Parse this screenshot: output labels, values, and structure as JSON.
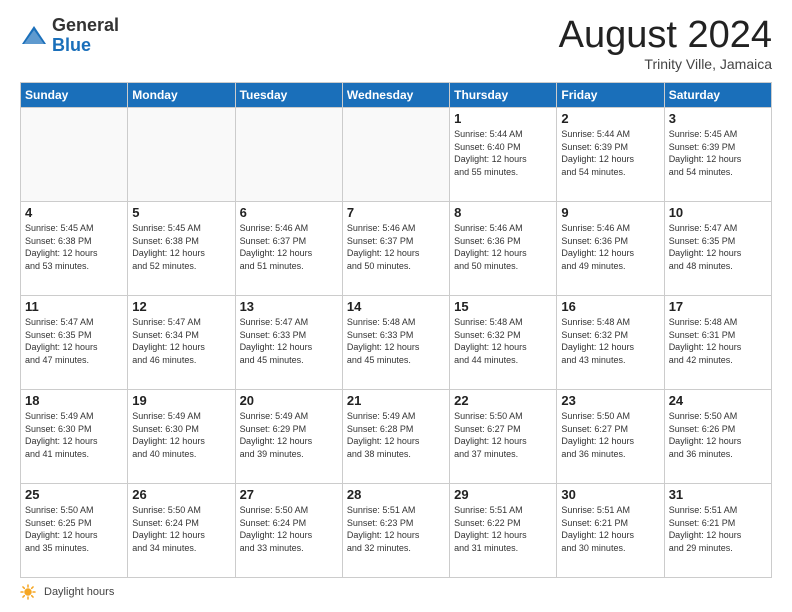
{
  "logo": {
    "general": "General",
    "blue": "Blue"
  },
  "title": "August 2024",
  "location": "Trinity Ville, Jamaica",
  "days_header": [
    "Sunday",
    "Monday",
    "Tuesday",
    "Wednesday",
    "Thursday",
    "Friday",
    "Saturday"
  ],
  "footer_label": "Daylight hours",
  "weeks": [
    [
      {
        "day": "",
        "info": ""
      },
      {
        "day": "",
        "info": ""
      },
      {
        "day": "",
        "info": ""
      },
      {
        "day": "",
        "info": ""
      },
      {
        "day": "1",
        "info": "Sunrise: 5:44 AM\nSunset: 6:40 PM\nDaylight: 12 hours\nand 55 minutes."
      },
      {
        "day": "2",
        "info": "Sunrise: 5:44 AM\nSunset: 6:39 PM\nDaylight: 12 hours\nand 54 minutes."
      },
      {
        "day": "3",
        "info": "Sunrise: 5:45 AM\nSunset: 6:39 PM\nDaylight: 12 hours\nand 54 minutes."
      }
    ],
    [
      {
        "day": "4",
        "info": "Sunrise: 5:45 AM\nSunset: 6:38 PM\nDaylight: 12 hours\nand 53 minutes."
      },
      {
        "day": "5",
        "info": "Sunrise: 5:45 AM\nSunset: 6:38 PM\nDaylight: 12 hours\nand 52 minutes."
      },
      {
        "day": "6",
        "info": "Sunrise: 5:46 AM\nSunset: 6:37 PM\nDaylight: 12 hours\nand 51 minutes."
      },
      {
        "day": "7",
        "info": "Sunrise: 5:46 AM\nSunset: 6:37 PM\nDaylight: 12 hours\nand 50 minutes."
      },
      {
        "day": "8",
        "info": "Sunrise: 5:46 AM\nSunset: 6:36 PM\nDaylight: 12 hours\nand 50 minutes."
      },
      {
        "day": "9",
        "info": "Sunrise: 5:46 AM\nSunset: 6:36 PM\nDaylight: 12 hours\nand 49 minutes."
      },
      {
        "day": "10",
        "info": "Sunrise: 5:47 AM\nSunset: 6:35 PM\nDaylight: 12 hours\nand 48 minutes."
      }
    ],
    [
      {
        "day": "11",
        "info": "Sunrise: 5:47 AM\nSunset: 6:35 PM\nDaylight: 12 hours\nand 47 minutes."
      },
      {
        "day": "12",
        "info": "Sunrise: 5:47 AM\nSunset: 6:34 PM\nDaylight: 12 hours\nand 46 minutes."
      },
      {
        "day": "13",
        "info": "Sunrise: 5:47 AM\nSunset: 6:33 PM\nDaylight: 12 hours\nand 45 minutes."
      },
      {
        "day": "14",
        "info": "Sunrise: 5:48 AM\nSunset: 6:33 PM\nDaylight: 12 hours\nand 45 minutes."
      },
      {
        "day": "15",
        "info": "Sunrise: 5:48 AM\nSunset: 6:32 PM\nDaylight: 12 hours\nand 44 minutes."
      },
      {
        "day": "16",
        "info": "Sunrise: 5:48 AM\nSunset: 6:32 PM\nDaylight: 12 hours\nand 43 minutes."
      },
      {
        "day": "17",
        "info": "Sunrise: 5:48 AM\nSunset: 6:31 PM\nDaylight: 12 hours\nand 42 minutes."
      }
    ],
    [
      {
        "day": "18",
        "info": "Sunrise: 5:49 AM\nSunset: 6:30 PM\nDaylight: 12 hours\nand 41 minutes."
      },
      {
        "day": "19",
        "info": "Sunrise: 5:49 AM\nSunset: 6:30 PM\nDaylight: 12 hours\nand 40 minutes."
      },
      {
        "day": "20",
        "info": "Sunrise: 5:49 AM\nSunset: 6:29 PM\nDaylight: 12 hours\nand 39 minutes."
      },
      {
        "day": "21",
        "info": "Sunrise: 5:49 AM\nSunset: 6:28 PM\nDaylight: 12 hours\nand 38 minutes."
      },
      {
        "day": "22",
        "info": "Sunrise: 5:50 AM\nSunset: 6:27 PM\nDaylight: 12 hours\nand 37 minutes."
      },
      {
        "day": "23",
        "info": "Sunrise: 5:50 AM\nSunset: 6:27 PM\nDaylight: 12 hours\nand 36 minutes."
      },
      {
        "day": "24",
        "info": "Sunrise: 5:50 AM\nSunset: 6:26 PM\nDaylight: 12 hours\nand 36 minutes."
      }
    ],
    [
      {
        "day": "25",
        "info": "Sunrise: 5:50 AM\nSunset: 6:25 PM\nDaylight: 12 hours\nand 35 minutes."
      },
      {
        "day": "26",
        "info": "Sunrise: 5:50 AM\nSunset: 6:24 PM\nDaylight: 12 hours\nand 34 minutes."
      },
      {
        "day": "27",
        "info": "Sunrise: 5:50 AM\nSunset: 6:24 PM\nDaylight: 12 hours\nand 33 minutes."
      },
      {
        "day": "28",
        "info": "Sunrise: 5:51 AM\nSunset: 6:23 PM\nDaylight: 12 hours\nand 32 minutes."
      },
      {
        "day": "29",
        "info": "Sunrise: 5:51 AM\nSunset: 6:22 PM\nDaylight: 12 hours\nand 31 minutes."
      },
      {
        "day": "30",
        "info": "Sunrise: 5:51 AM\nSunset: 6:21 PM\nDaylight: 12 hours\nand 30 minutes."
      },
      {
        "day": "31",
        "info": "Sunrise: 5:51 AM\nSunset: 6:21 PM\nDaylight: 12 hours\nand 29 minutes."
      }
    ]
  ]
}
